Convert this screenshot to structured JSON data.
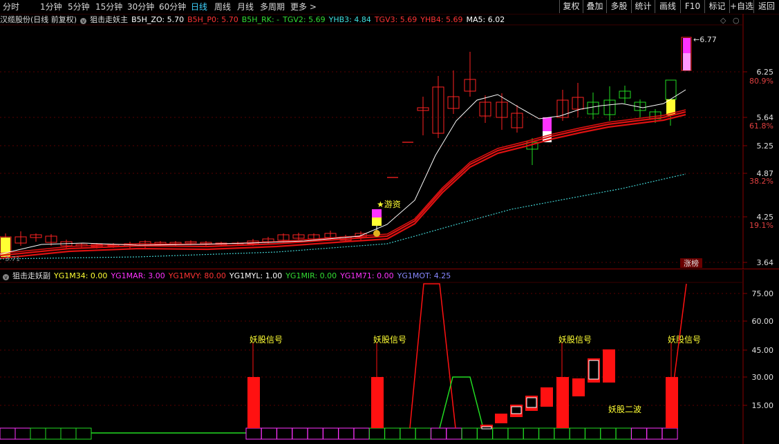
{
  "toolbar": {
    "tabs": [
      "分时",
      "1分钟",
      "5分钟",
      "15分钟",
      "30分钟",
      "60分钟",
      "日线",
      "周线",
      "月线",
      "多周期",
      "更多 >"
    ],
    "active_tab": "日线",
    "right_buttons": [
      "复权",
      "叠加",
      "多股",
      "统计",
      "画线",
      "F10",
      "标记",
      "+自选",
      "返回"
    ]
  },
  "main_panel": {
    "stock_label": "汉缆股份(日线 前复权)",
    "indicator_name": "狙击走妖主",
    "params": [
      {
        "label": "B5H_ZO: 5.70",
        "color": "#ffffff"
      },
      {
        "label": "B5H_P0: 5.70",
        "color": "#ff3333"
      },
      {
        "label": "B5H_RK: -",
        "color": "#33dd33"
      },
      {
        "label": "TGV2: 5.69",
        "color": "#33dd33"
      },
      {
        "label": "YHB3: 4.84",
        "color": "#40e0e0"
      },
      {
        "label": "TGV3: 5.69",
        "color": "#ff3333"
      },
      {
        "label": "YHB4: 5.69",
        "color": "#ff3333"
      },
      {
        "label": "MA5: 6.02",
        "color": "#ffffff"
      }
    ],
    "price_ticks": [
      "6.25",
      "5.64",
      "5.25",
      "4.87",
      "4.25",
      "3.64"
    ],
    "pct_ticks": [
      "80.9%",
      "61.8%",
      "38.2%",
      "19.1%"
    ],
    "high_label": "6.77",
    "low_label": "3.71",
    "annotation_youzi": "★游资",
    "badge": "涨榜",
    "colors": {
      "up": "#ff2222",
      "down": "#22dd22",
      "ma5": "#ffffff",
      "dotted": "#40d0d0",
      "signal": "#ffff33",
      "magenta": "#ff33ff"
    }
  },
  "sub_panel": {
    "indicator_name": "狙击走妖副",
    "params": [
      {
        "label": "YG1M34: 0.00",
        "color": "#ffff33"
      },
      {
        "label": "YG1MAR: 3.00",
        "color": "#ff33ff"
      },
      {
        "label": "YG1MVY: 80.00",
        "color": "#ff3333"
      },
      {
        "label": "YG1MYL: 1.00",
        "color": "#ffffff"
      },
      {
        "label": "YG1MIR: 0.00",
        "color": "#33dd33"
      },
      {
        "label": "YG1M71: 0.00",
        "color": "#ff33ff"
      },
      {
        "label": "YG1MOT: 4.25",
        "color": "#8888ff"
      }
    ],
    "ticks": [
      "75.00",
      "60.00",
      "45.00",
      "30.00",
      "15.00"
    ],
    "signal_label": "妖股信号",
    "second_wave_label": "妖股二波"
  }
}
